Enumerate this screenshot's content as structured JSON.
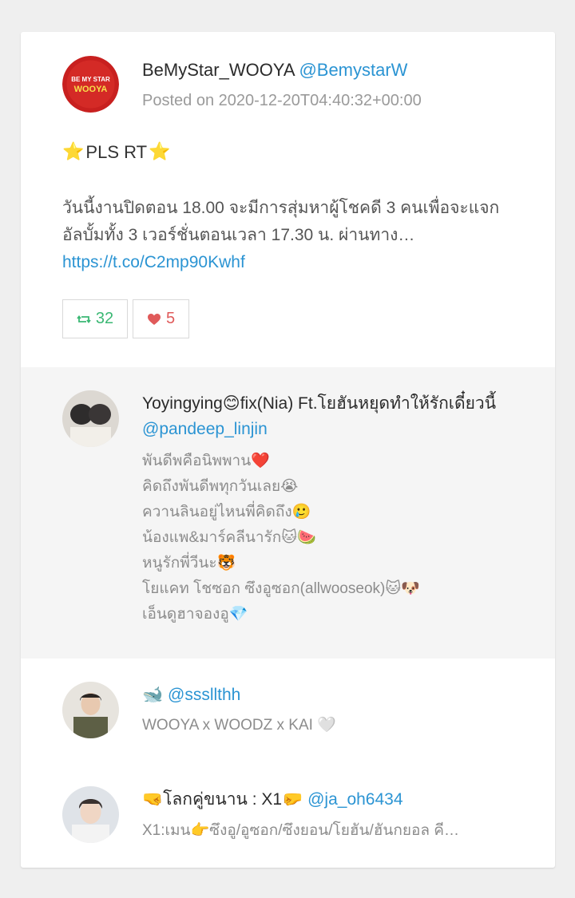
{
  "main": {
    "display_name": "BeMyStar_WOOYA",
    "handle": "@BemystarW",
    "posted": "Posted on 2020-12-20T04:40:32+00:00",
    "star_left": "⭐",
    "headline": "PLS RT",
    "star_right": "⭐",
    "text": "วันนี้งานปิดตอน 18.00 จะมีการสุ่มหาผู้โชคดี 3 คนเพื่อจะแจกอัลบั้มทั้ง 3 เวอร์ชั่นตอนเวลา 17.30 น. ผ่านทาง…",
    "link": "https://t.co/C2mp90Kwhf",
    "retweets": "32",
    "likes": "5",
    "avatar_text_top": "BE MY STAR",
    "avatar_text_bottom": "WOOYA"
  },
  "replies": [
    {
      "name": "Yoyingying😊fix(Nia) Ft.โยฮันหยุดทำให้รักเดี๋ยวนี้",
      "handle": "@pandeep_linjin",
      "body": "พันดีพคือนิพพาน❤️\nคิดถึงพันดีพทุกวันเลย😭\nควานลินอยู่ไหนพี่คิดถึง🥲\nน้องแพ&มาร์คลีนารัก🐱🍉\nหนูรักพี่วีนะ🐯\nโยแคท โชซอก ซึงอูซอก(allwooseok)🐱🐶\nเอ็นดูฮาจองอู💎"
    },
    {
      "name": "🐋",
      "handle": "@sssllthh",
      "body": "WOOYA x WOODZ x KAI 🤍"
    },
    {
      "name": "🤜โลกคู่ขนาน : X1🤛",
      "handle": "@ja_oh6434",
      "body": "X1:เมน👉ซึงอู/อูซอก/ซึงยอน/โยฮัน/ฮันกยอล คี…"
    }
  ]
}
